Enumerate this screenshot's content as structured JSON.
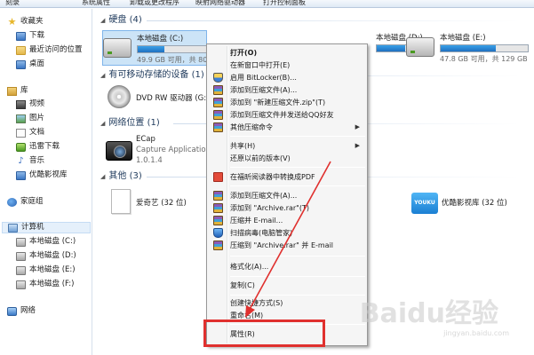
{
  "toolbar": {
    "items": [
      "刻录",
      "系统属性",
      "卸载或更改程序",
      "映射网络驱动器",
      "打开控制面板"
    ]
  },
  "nav": {
    "favorites_label": "收藏夹",
    "favorites": [
      "下载",
      "最近访问的位置",
      "桌面"
    ],
    "libraries_label": "库",
    "libraries": [
      "视频",
      "图片",
      "文档",
      "迅雷下载",
      "音乐",
      "优酷影视库"
    ],
    "homegroup_label": "家庭组",
    "computer_label": "计算机",
    "drives": [
      "本地磁盘 (C:)",
      "本地磁盘 (D:)",
      "本地磁盘 (E:)",
      "本地磁盘 (F:)"
    ],
    "network_label": "网络"
  },
  "main": {
    "hard_disks_header": "硬盘 (4)",
    "drives": [
      {
        "name": "本地磁盘 (C:)",
        "capacity": "49.9 GB 可用，共 80.0",
        "fill": 0.38
      },
      {
        "name": "本地磁盘 (D:)",
        "capacity": "",
        "fill": 0.72
      },
      {
        "name": "本地磁盘 (E:)",
        "capacity": "47.8 GB 可用，共 129 GB",
        "fill": 0.63
      }
    ],
    "removable_header": "有可移动存储的设备 (1)",
    "dvd_label": "DVD RW 驱动器 (G:)",
    "network_header": "网络位置 (1)",
    "ecap_name": "ECap",
    "ecap_type": "Capture Application",
    "ecap_version": "1.0.1.4",
    "other_header": "其他 (3)",
    "other_items": [
      "爱奇艺 (32 位)",
      "优酷影视库 (32 位)"
    ],
    "youku_logo": "YOUKU"
  },
  "context_menu": {
    "items": [
      {
        "label": "打开(O)",
        "bold": true,
        "icon": ""
      },
      {
        "label": "在新窗口中打开(E)",
        "icon": ""
      },
      {
        "label": "启用 BitLocker(B)...",
        "icon": "shield-icon"
      },
      {
        "label": "添加到压缩文件(A)...",
        "icon": "rar-icon"
      },
      {
        "label": "添加到 \"新建压缩文件.zip\"(T)",
        "icon": "rar-icon"
      },
      {
        "label": "添加到压缩文件并发送给QQ好友",
        "icon": "rar-icon"
      },
      {
        "label": "其他压缩命令",
        "icon": "rar-icon",
        "submenu": true
      },
      {
        "label": "共享(H)",
        "submenu": true
      },
      {
        "label": "还原以前的版本(V)"
      },
      {
        "label": "在福昕阅读器中转换成PDF",
        "icon": "pdf-icon"
      },
      {
        "label": "添加到压缩文件(A)...",
        "icon": "rar-icon"
      },
      {
        "label": "添加到 \"Archive.rar\"(T)",
        "icon": "rar-icon"
      },
      {
        "label": "压缩并 E-mail...",
        "icon": "rar-icon"
      },
      {
        "label": "扫描病毒(电脑管家)",
        "icon": "blue-shield-icon"
      },
      {
        "label": "压缩到 \"Archive.rar\" 并 E-mail",
        "icon": "rar-icon"
      },
      {
        "label": "格式化(A)..."
      },
      {
        "label": "复制(C)"
      },
      {
        "label": "创建快捷方式(S)"
      },
      {
        "label": "重命名(M)"
      },
      {
        "label": "属性(R)"
      }
    ]
  },
  "colors": {
    "highlight": "#e0302e",
    "selection_bg": "#cce4f7",
    "bar_fill": "#1f6fc0"
  },
  "watermark": {
    "brand": "Baidu经验",
    "url": "jingyan.baidu.com"
  }
}
